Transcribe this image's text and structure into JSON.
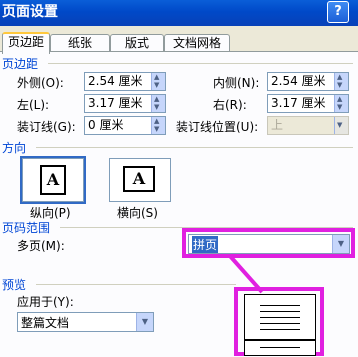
{
  "window": {
    "title": "页面设置",
    "help": "?"
  },
  "tabs": [
    "页边距",
    "纸张",
    "版式",
    "文档网格"
  ],
  "margins": {
    "section": "页边距",
    "outer_label": "外侧(O):",
    "outer_value": "2.54 厘米",
    "inner_label": "内侧(N):",
    "inner_value": "2.54 厘米",
    "left_label": "左(L):",
    "left_value": "3.17 厘米",
    "right_label": "右(R):",
    "right_value": "3.17 厘米",
    "gutter_label": "装订线(G):",
    "gutter_value": "0 厘米",
    "gutter_pos_label": "装订线位置(U):",
    "gutter_pos_value": "上"
  },
  "orientation": {
    "section": "方向",
    "portrait_label": "纵向(P)",
    "landscape_label": "横向(S)",
    "icon_letter": "A"
  },
  "pages": {
    "section": "页码范围",
    "multiple_label": "多页(M):",
    "multiple_value": "拼页"
  },
  "preview": {
    "section": "预览",
    "apply_label": "应用于(Y):",
    "apply_value": "整篇文档"
  }
}
